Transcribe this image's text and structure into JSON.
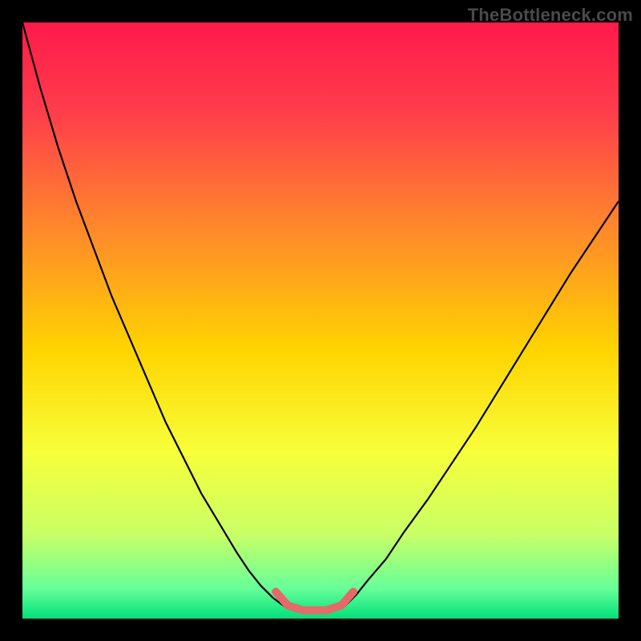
{
  "watermark": "TheBottleneck.com",
  "chart_data": {
    "type": "line",
    "title": "",
    "xlabel": "",
    "ylabel": "",
    "xlim": [
      0,
      100
    ],
    "ylim": [
      0,
      100
    ],
    "grid": false,
    "legend": false,
    "gradient_stops": [
      {
        "offset": 0.0,
        "color": "#ff1a4b"
      },
      {
        "offset": 0.15,
        "color": "#ff3d4b"
      },
      {
        "offset": 0.35,
        "color": "#ff8a2a"
      },
      {
        "offset": 0.55,
        "color": "#ffd400"
      },
      {
        "offset": 0.72,
        "color": "#f7ff3a"
      },
      {
        "offset": 0.86,
        "color": "#c8ff66"
      },
      {
        "offset": 0.95,
        "color": "#66ff99"
      },
      {
        "offset": 1.0,
        "color": "#00e07a"
      }
    ],
    "series": [
      {
        "name": "left-curve",
        "stroke": "#000000",
        "stroke_width": 2.2,
        "x": [
          0,
          3,
          6,
          9,
          12,
          15,
          18,
          21,
          24,
          27,
          30,
          33,
          36,
          38,
          40,
          42,
          44
        ],
        "y": [
          100,
          89,
          79,
          70,
          62,
          54,
          47,
          40,
          33,
          27,
          21,
          16,
          11,
          8,
          5.5,
          3.5,
          2
        ]
      },
      {
        "name": "right-curve",
        "stroke": "#000000",
        "stroke_width": 2.2,
        "x": [
          54,
          56,
          58,
          61,
          64,
          68,
          72,
          76,
          80,
          84,
          88,
          92,
          96,
          100
        ],
        "y": [
          2,
          4,
          6.5,
          10,
          14.5,
          20,
          26,
          32,
          38.5,
          45,
          51.5,
          58,
          64,
          70
        ]
      },
      {
        "name": "bottom-highlight",
        "stroke": "#e46a6a",
        "stroke_width": 10,
        "linecap": "round",
        "x": [
          42.5,
          44.5,
          47,
          51,
          53.5,
          55.5
        ],
        "y": [
          4.5,
          2.2,
          1.4,
          1.4,
          2.2,
          4.5
        ]
      }
    ]
  }
}
